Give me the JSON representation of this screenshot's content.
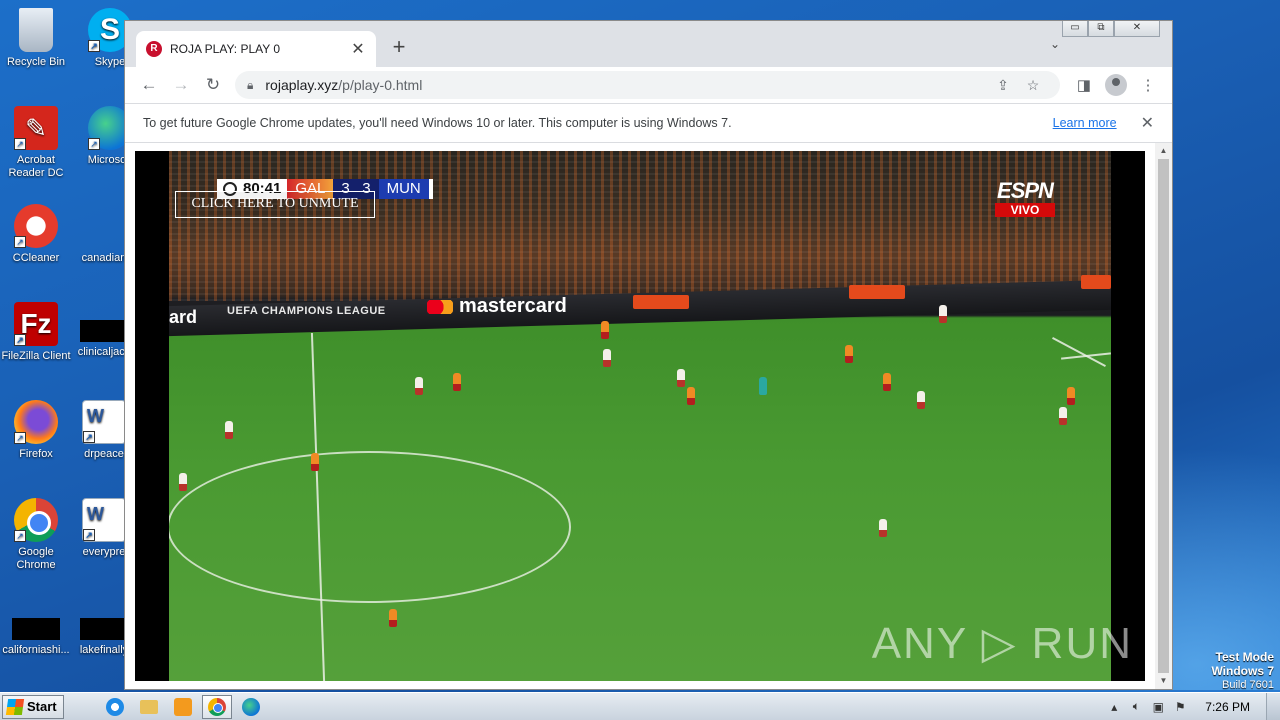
{
  "desktop": {
    "icons": [
      {
        "label": "Recycle Bin",
        "icon": "recycle-bin-icon"
      },
      {
        "label": "Skype",
        "icon": "skype-icon"
      },
      {
        "label": "Acrobat Reader DC",
        "icon": "acrobat-icon"
      },
      {
        "label": "Microsoft",
        "icon": "edge-icon"
      },
      {
        "label": "CCleaner",
        "icon": "ccleaner-icon"
      },
      {
        "label": "canadian",
        "icon": "file-icon"
      },
      {
        "label": "FileZilla Client",
        "icon": "filezilla-icon"
      },
      {
        "label": "clinicaljack",
        "icon": "file-icon"
      },
      {
        "label": "Firefox",
        "icon": "firefox-icon"
      },
      {
        "label": "drpeace",
        "icon": "word-icon"
      },
      {
        "label": "Google Chrome",
        "icon": "chrome-icon"
      },
      {
        "label": "everypre",
        "icon": "word-icon"
      },
      {
        "label": "californiashi...",
        "icon": "file-icon"
      },
      {
        "label": "lakefinally",
        "icon": "file-icon"
      }
    ],
    "test_mode": {
      "line1": "Test Mode",
      "line2": "Windows 7",
      "line3": "Build 7601"
    }
  },
  "browser": {
    "tab": {
      "title": "ROJA PLAY: PLAY 0",
      "favicon": "R"
    },
    "window_buttons": {
      "minimize": "▭",
      "maximize": "⧉",
      "close": "✕"
    },
    "url_host": "rojaplay.xyz",
    "url_path": "/p/play-0.html",
    "infobar": {
      "message": "To get future Google Chrome updates, you'll need Windows 10 or later. This computer is using Windows 7.",
      "link": "Learn more"
    }
  },
  "video": {
    "clock": "80:41",
    "home_team": "GAL",
    "home_score": "3",
    "away_score": "3",
    "away_team": "MUN",
    "unmute_label": "CLICK HERE TO UNMUTE",
    "broadcaster": "ESPN",
    "broadcaster_tag": "VIVO",
    "ad_ucl": "UEFA CHAMPIONS LEAGUE",
    "ad_mastercard": "mastercard",
    "ad_card": "ard",
    "watermark": "ANY ▷ RUN"
  },
  "taskbar": {
    "start_label": "Start",
    "time": "7:26 PM"
  },
  "colors": {
    "desktop": "#1a5fb4",
    "tab_strip": "#dee1e6",
    "link": "#1a73e8",
    "espn_red": "#d50a0a"
  }
}
